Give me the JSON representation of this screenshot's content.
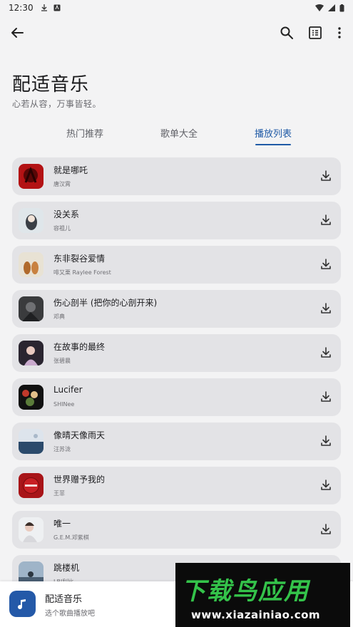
{
  "status_bar": {
    "time": "12:30"
  },
  "header": {
    "title": "配适音乐",
    "subtitle": "心若从容，万事皆轻。"
  },
  "tabs": [
    {
      "label": "热门推荐",
      "active": false
    },
    {
      "label": "歌单大全",
      "active": false
    },
    {
      "label": "播放列表",
      "active": true
    }
  ],
  "songs": [
    {
      "title": "就是哪吒",
      "artist": "唐汉霄"
    },
    {
      "title": "没关系",
      "artist": "容祖儿"
    },
    {
      "title": "东非裂谷爱情",
      "artist": "啡又栗 Raylee Forest"
    },
    {
      "title": "伤心剖半 (把你的心剖开来)",
      "artist": "邓典"
    },
    {
      "title": "在故事的最终",
      "artist": "张碧晨"
    },
    {
      "title": "Lucifer",
      "artist": "SHINee"
    },
    {
      "title": "像晴天像雨天",
      "artist": "汪苏泷"
    },
    {
      "title": "世界赠予我的",
      "artist": "王菲"
    },
    {
      "title": "唯一",
      "artist": "G.E.M.邓紫棋"
    },
    {
      "title": "跳楼机",
      "artist": "LBI利比"
    }
  ],
  "player": {
    "title": "配适音乐",
    "subtitle": "选个歌曲播放吧"
  },
  "watermark": {
    "logo": "下载鸟应用",
    "url": "www.xiazainiao.com"
  },
  "colors": {
    "accent": "#1f5aa6",
    "card": "#e3e3e6",
    "background": "#f3f3f4"
  }
}
